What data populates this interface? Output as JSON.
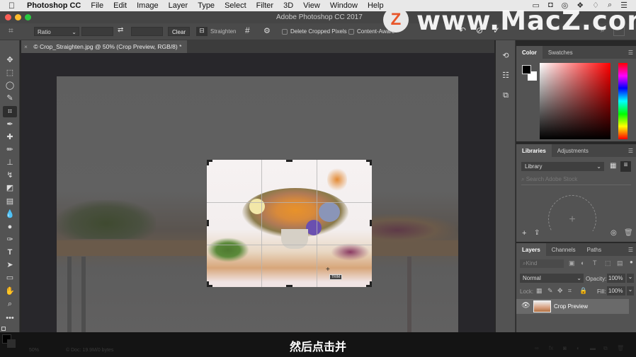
{
  "menubar": {
    "apple": "",
    "app_name": "Photoshop CC",
    "items": [
      "File",
      "Edit",
      "Image",
      "Layer",
      "Type",
      "Select",
      "Filter",
      "3D",
      "View",
      "Window",
      "Help"
    ],
    "status_icons": [
      "display-icon",
      "camera-icon",
      "creative-cloud-icon",
      "dropbox-icon",
      "wifi-icon",
      "search-icon",
      "list-icon"
    ]
  },
  "window": {
    "title": "Adobe Photoshop CC 2017"
  },
  "options_bar": {
    "ratio_select": "Ratio",
    "width_value": "",
    "height_value": "",
    "swap_icon": "⇄",
    "clear_label": "Clear",
    "straighten_label": "Straighten",
    "delete_cropped_label": "Delete Cropped Pixels",
    "delete_cropped_checked": false,
    "content_aware_label": "Content-Aware",
    "content_aware_checked": false
  },
  "document_tab": {
    "title": "© Crop_Straighten.jpg @ 50% (Crop Preview, RGB/8) *",
    "close": "×"
  },
  "tools": [
    "move",
    "marquee",
    "lasso",
    "quick-select",
    "crop",
    "eyedropper",
    "healing",
    "brush",
    "clone-stamp",
    "history-brush",
    "eraser",
    "gradient",
    "blur",
    "dodge",
    "pen",
    "type",
    "path-select",
    "rectangle",
    "hand",
    "zoom",
    "more"
  ],
  "active_tool": "crop",
  "canvas": {
    "cursor_label": "TRIM"
  },
  "color_panel": {
    "tabs": [
      "Color",
      "Swatches"
    ],
    "active_tab": "Color",
    "foreground": "#000000",
    "background": "#ffffff",
    "hue_color": "#ff0000"
  },
  "libraries_panel": {
    "tabs": [
      "Libraries",
      "Adjustments"
    ],
    "active_tab": "Libraries",
    "library_select": "Library",
    "search_placeholder": "Search Adobe Stock"
  },
  "layers_panel": {
    "tabs": [
      "Layers",
      "Channels",
      "Paths"
    ],
    "active_tab": "Layers",
    "filter_placeholder": "Kind",
    "blend_mode": "Normal",
    "opacity_label": "Opacity:",
    "opacity_value": "100%",
    "lock_label": "Lock:",
    "fill_label": "Fill:",
    "fill_value": "100%",
    "layers": [
      {
        "name": "Crop Preview",
        "visible": true
      }
    ]
  },
  "status_bar": {
    "zoom": "50%",
    "doc_info": "© Doc: 19.9M/0 bytes"
  },
  "subtitle": "然后点击并",
  "watermark": {
    "logo": "Z",
    "text": "www.MacZ.com"
  }
}
